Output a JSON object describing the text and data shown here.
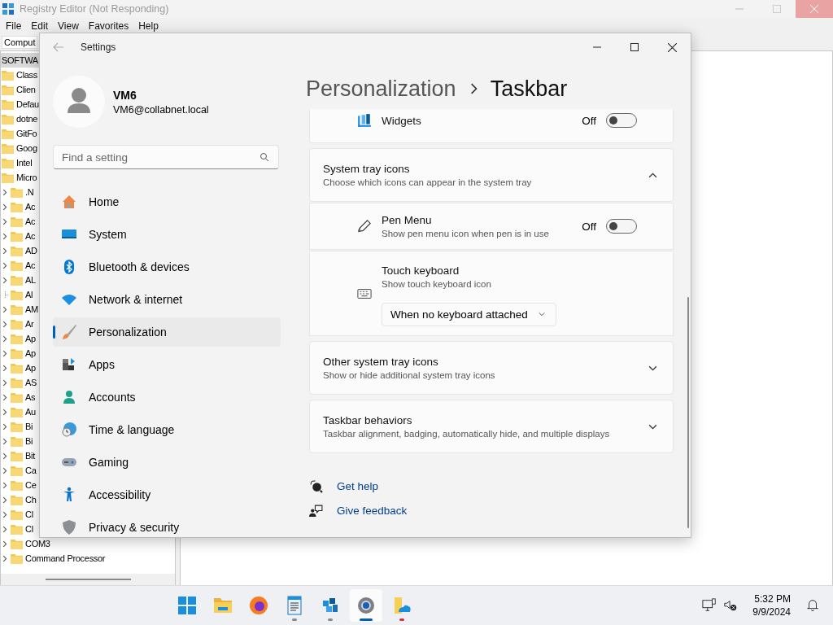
{
  "registry": {
    "title": "Registry Editor (Not Responding)",
    "menu": [
      "File",
      "Edit",
      "View",
      "Favorites",
      "Help"
    ],
    "address": "Comput",
    "tree": [
      {
        "label": "SOFTWA",
        "selected": true,
        "children": [
          {
            "label": "Class",
            "selected": false
          },
          {
            "label": "Clien",
            "selected": false
          },
          {
            "label": "Defau",
            "selected": false
          },
          {
            "label": "dotne",
            "selected": false
          },
          {
            "label": "GitFo",
            "selected": false
          },
          {
            "label": "Goog",
            "selected": false
          },
          {
            "label": "Intel",
            "selected": false
          },
          {
            "label": "Micro",
            "selected": false,
            "children": [
              {
                "label": ".N",
                "selected": false,
                "expandable": true
              },
              {
                "label": "Ac",
                "selected": false,
                "expandable": true
              },
              {
                "label": "Ac",
                "selected": false,
                "expandable": true
              },
              {
                "label": "Ac",
                "selected": false,
                "expandable": true
              },
              {
                "label": "AD",
                "selected": false,
                "expandable": true
              },
              {
                "label": "Ac",
                "selected": false,
                "expandable": true
              },
              {
                "label": "AL",
                "selected": false,
                "expandable": true
              },
              {
                "label": "Al",
                "selected": false,
                "expandable": false
              },
              {
                "label": "AM",
                "selected": false,
                "expandable": true
              },
              {
                "label": "Ar",
                "selected": false,
                "expandable": true
              },
              {
                "label": "Ap",
                "selected": false,
                "expandable": true
              },
              {
                "label": "Ap",
                "selected": false,
                "expandable": true
              },
              {
                "label": "Ap",
                "selected": false,
                "expandable": true
              },
              {
                "label": "AS",
                "selected": false,
                "expandable": true
              },
              {
                "label": "As",
                "selected": false,
                "expandable": true
              },
              {
                "label": "Au",
                "selected": false,
                "expandable": true
              },
              {
                "label": "Bi",
                "selected": false,
                "expandable": true
              },
              {
                "label": "Bi",
                "selected": false,
                "expandable": true
              },
              {
                "label": "Bit",
                "selected": false,
                "expandable": true
              },
              {
                "label": "Ca",
                "selected": false,
                "expandable": true
              },
              {
                "label": "Ce",
                "selected": false,
                "expandable": true
              },
              {
                "label": "Ch",
                "selected": false,
                "expandable": true
              },
              {
                "label": "Cl",
                "selected": false,
                "expandable": true
              },
              {
                "label": "Cl",
                "selected": false,
                "expandable": true
              },
              {
                "label": "COM3",
                "selected": false,
                "expandable": true
              },
              {
                "label": "Command Processor",
                "selected": false,
                "expandable": true
              }
            ]
          }
        ]
      }
    ]
  },
  "settings": {
    "title": "Settings",
    "user": {
      "name": "VM6",
      "email": "VM6@collabnet.local"
    },
    "search": {
      "placeholder": "Find a setting"
    },
    "nav": [
      {
        "label": "Home",
        "selected": false
      },
      {
        "label": "System",
        "selected": false
      },
      {
        "label": "Bluetooth & devices",
        "selected": false
      },
      {
        "label": "Network & internet",
        "selected": false
      },
      {
        "label": "Personalization",
        "selected": true
      },
      {
        "label": "Apps",
        "selected": false
      },
      {
        "label": "Accounts",
        "selected": false
      },
      {
        "label": "Time & language",
        "selected": false
      },
      {
        "label": "Gaming",
        "selected": false
      },
      {
        "label": "Accessibility",
        "selected": false
      },
      {
        "label": "Privacy & security",
        "selected": false
      }
    ],
    "breadcrumb": {
      "parent": "Personalization",
      "current": "Taskbar"
    },
    "sections": [
      {
        "kind": "toggle",
        "label": "Widgets",
        "state_text": "Off",
        "on": false
      },
      {
        "kind": "expander",
        "title": "System tray icons",
        "subtitle": "Choose which icons can appear in the system tray",
        "expanded": true,
        "children": [
          {
            "kind": "toggle",
            "label": "Pen Menu",
            "description": "Show pen menu icon when pen is in use",
            "state_text": "Off",
            "on": false
          },
          {
            "kind": "dropdown",
            "label": "Touch keyboard",
            "description": "Show touch keyboard icon",
            "value": "When no keyboard attached"
          }
        ]
      },
      {
        "kind": "expander",
        "title": "Other system tray icons",
        "subtitle": "Show or hide additional system tray icons",
        "expanded": false
      },
      {
        "kind": "expander",
        "title": "Taskbar behaviors",
        "subtitle": "Taskbar alignment, badging, automatically hide, and multiple displays",
        "expanded": false
      }
    ],
    "links": [
      "Get help",
      "Give feedback"
    ]
  },
  "taskbar": {
    "apps": [
      {
        "selected": false,
        "running": false,
        "alert": false
      },
      {
        "selected": false,
        "running": false,
        "alert": false
      },
      {
        "selected": false,
        "running": false,
        "alert": false
      },
      {
        "selected": false,
        "running": true,
        "alert": false
      },
      {
        "selected": false,
        "running": true,
        "alert": false
      },
      {
        "selected": true,
        "running": true,
        "alert": false
      },
      {
        "selected": false,
        "running": true,
        "alert": true
      }
    ],
    "clock": {
      "time": "5:32 PM",
      "date": "9/9/2024"
    }
  }
}
